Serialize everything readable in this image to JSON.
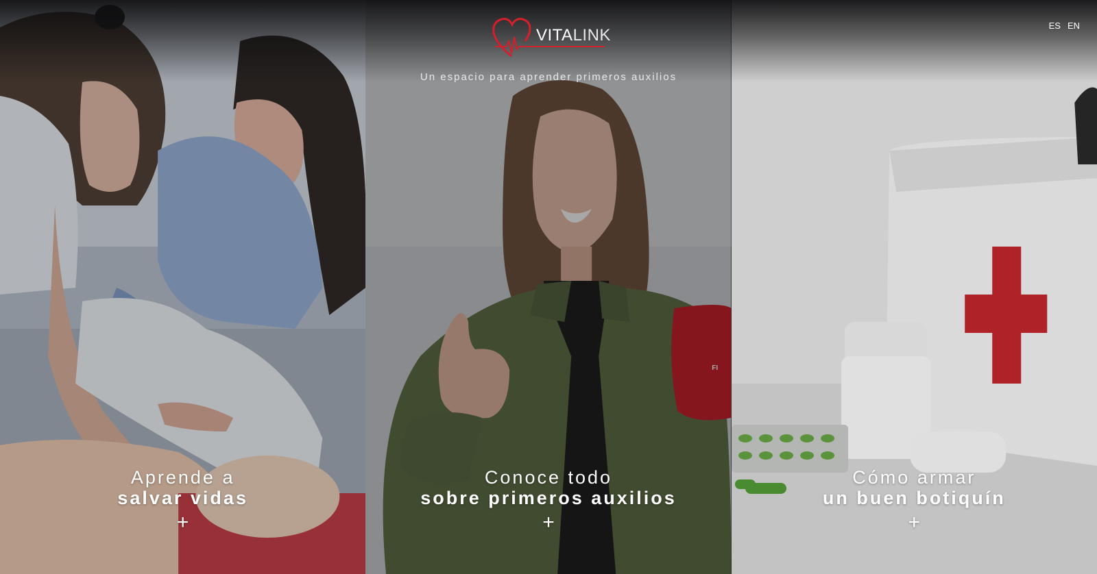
{
  "brand": {
    "name_bold": "VITA",
    "name_light": "LINK",
    "tagline": "Un espacio para aprender primeros auxilios",
    "accent_color": "#d3202a"
  },
  "languages": [
    "ES",
    "EN"
  ],
  "panels": [
    {
      "line1": "Aprende a",
      "line2": "salvar vidas",
      "plus": "+",
      "image": "cpr-training-photo"
    },
    {
      "line1": "Conoce todo",
      "line2": "sobre primeros auxilios",
      "plus": "+",
      "image": "woman-thumbs-up-photo"
    },
    {
      "line1": "Cómo armar",
      "line2": "un buen botiquín",
      "plus": "+",
      "image": "first-aid-kit-photo"
    }
  ]
}
